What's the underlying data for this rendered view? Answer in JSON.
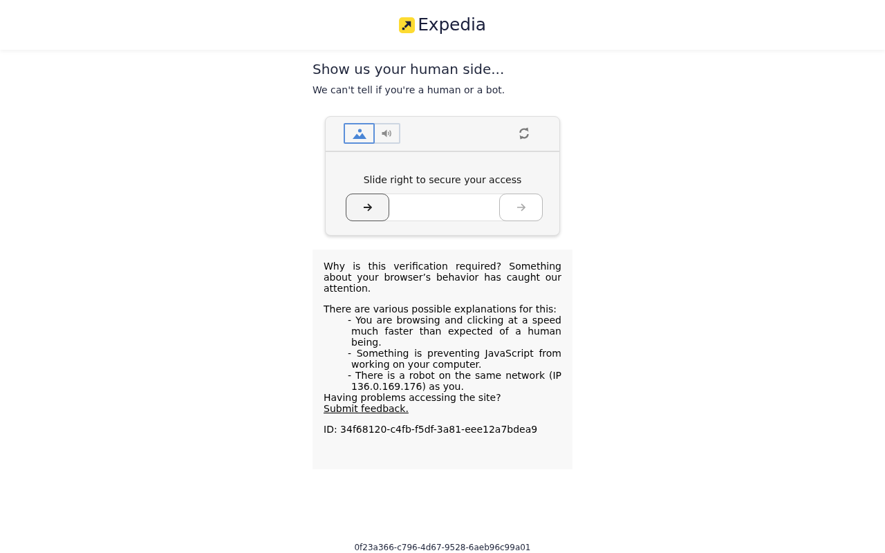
{
  "header": {
    "logo_text": "Expedia"
  },
  "heading": "Show us your human side...",
  "subheading": "We can't tell if you're a human or a bot.",
  "captcha": {
    "modes": [
      {
        "kind": "image",
        "selected": true
      },
      {
        "kind": "audio",
        "selected": false
      }
    ],
    "instruction": "Slide right to secure your access",
    "slider": {
      "level": 0
    }
  },
  "info": {
    "intro": "Why is this verification required? Something about your browser’s behavior has caught our attention.",
    "reasons_title": "There are various possible explanations for this:",
    "reasons": [
      "- You are browsing and clicking at a speed much faster than expected of a human being.",
      "- Something is preventing JavaScript from working on your computer.",
      "- There is a robot on the same network (IP 136.0.169.176) as you."
    ],
    "help_text": "Having problems accessing the site?",
    "feedback_link": "Submit feedback.",
    "id_text": "ID: 34f68120-c4fb-f5df-3a81-eee12a7bdea9"
  },
  "footer_id": "0f23a366-c796-4d67-9528-6aeb96c99a01"
}
